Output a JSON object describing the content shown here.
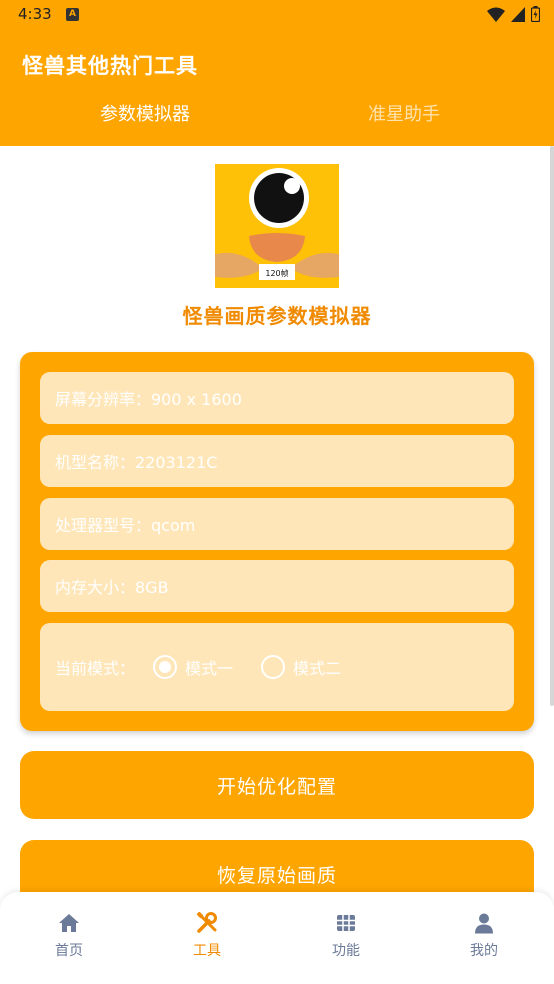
{
  "status_bar": {
    "time": "4:33"
  },
  "app_bar": {
    "title": "怪兽其他热门工具",
    "tabs": [
      {
        "label": "参数模拟器",
        "active": true
      },
      {
        "label": "准星助手",
        "active": false
      }
    ]
  },
  "logo": {
    "badge": "120帧"
  },
  "page_heading": "怪兽画质参数模拟器",
  "device_info": {
    "resolution": "屏幕分辨率：900 x 1600",
    "model": "机型名称：2203121C",
    "processor": "处理器型号：qcom",
    "memory": "内存大小：8GB",
    "mode_label": "当前模式：",
    "modes": [
      {
        "label": "模式一",
        "selected": true
      },
      {
        "label": "模式二",
        "selected": false
      }
    ]
  },
  "buttons": {
    "start": "开始优化配置",
    "restore": "恢复原始画质"
  },
  "bottom_nav": [
    {
      "label": "首页",
      "icon": "home-icon",
      "active": false
    },
    {
      "label": "工具",
      "icon": "tools-icon",
      "active": true
    },
    {
      "label": "功能",
      "icon": "grid-icon",
      "active": false
    },
    {
      "label": "我的",
      "icon": "person-icon",
      "active": false
    }
  ],
  "colors": {
    "primary": "#FFA500",
    "accent": "#F08A00",
    "field_bg": "#FFE6B8",
    "nav_inactive": "#6B7A99"
  }
}
